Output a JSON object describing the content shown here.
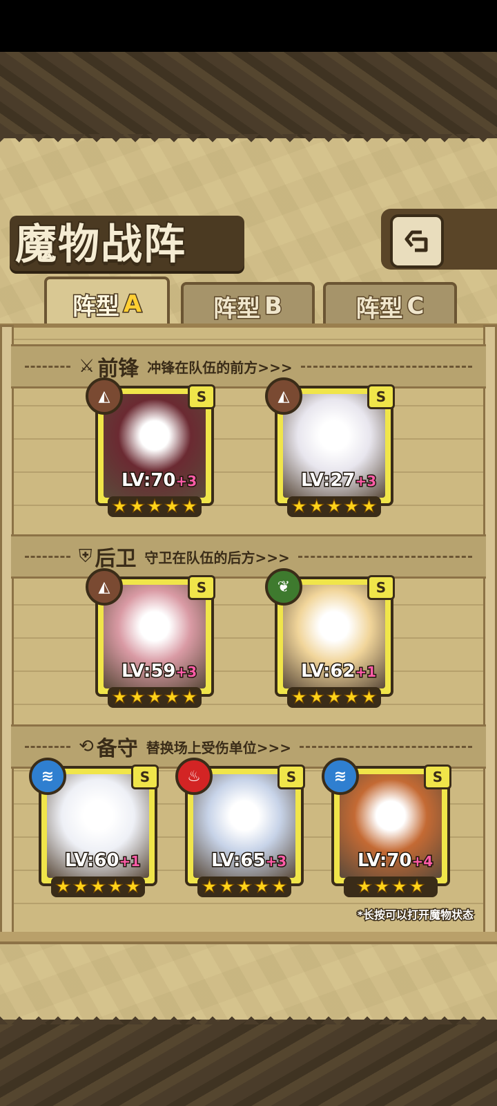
{
  "title": "魔物战阵",
  "back_icon": "back-arrow-icon",
  "tabs": [
    {
      "label": "阵型",
      "letter": "A",
      "active": true
    },
    {
      "label": "阵型",
      "letter": "B",
      "active": false
    },
    {
      "label": "阵型",
      "letter": "C",
      "active": false
    }
  ],
  "sections": [
    {
      "icon": "sword-icon",
      "name": "前锋",
      "desc": "冲锋在队伍的前方>>>"
    },
    {
      "icon": "shield-icon",
      "name": "后卫",
      "desc": "守卫在队伍的后方>>>"
    },
    {
      "icon": "swap-icon",
      "name": "备守",
      "desc": "替换场上受伤单位>>>"
    }
  ],
  "units": [
    {
      "section": "前锋",
      "rank": "S",
      "element": "earth",
      "element_color": "#7a4a32",
      "level": "LV:70",
      "plus": "+3",
      "stars": 5,
      "art_color": "#6b2a32"
    },
    {
      "section": "前锋",
      "rank": "S",
      "element": "earth",
      "element_color": "#7a4a32",
      "level": "LV:27",
      "plus": "+3",
      "stars": 5,
      "art_color": "#e8e6ee"
    },
    {
      "section": "后卫",
      "rank": "S",
      "element": "earth",
      "element_color": "#7a4a32",
      "level": "LV:59",
      "plus": "+3",
      "stars": 5,
      "art_color": "#d99aa4"
    },
    {
      "section": "后卫",
      "rank": "S",
      "element": "nature",
      "element_color": "#3e7a2e",
      "level": "LV:62",
      "plus": "+1",
      "stars": 5,
      "art_color": "#f1d59a"
    },
    {
      "section": "备守",
      "rank": "S",
      "element": "water",
      "element_color": "#2f7fd0",
      "level": "LV:60",
      "plus": "+1",
      "stars": 5,
      "art_color": "#eef0f6"
    },
    {
      "section": "备守",
      "rank": "S",
      "element": "fire",
      "element_color": "#d32424",
      "level": "LV:65",
      "plus": "+3",
      "stars": 5,
      "art_color": "#c7d3e8"
    },
    {
      "section": "备守",
      "rank": "S",
      "element": "water",
      "element_color": "#2f7fd0",
      "level": "LV:70",
      "plus": "+4",
      "stars": 4,
      "art_color": "#c46a34"
    }
  ],
  "hint": "*长按可以打开魔物状态"
}
